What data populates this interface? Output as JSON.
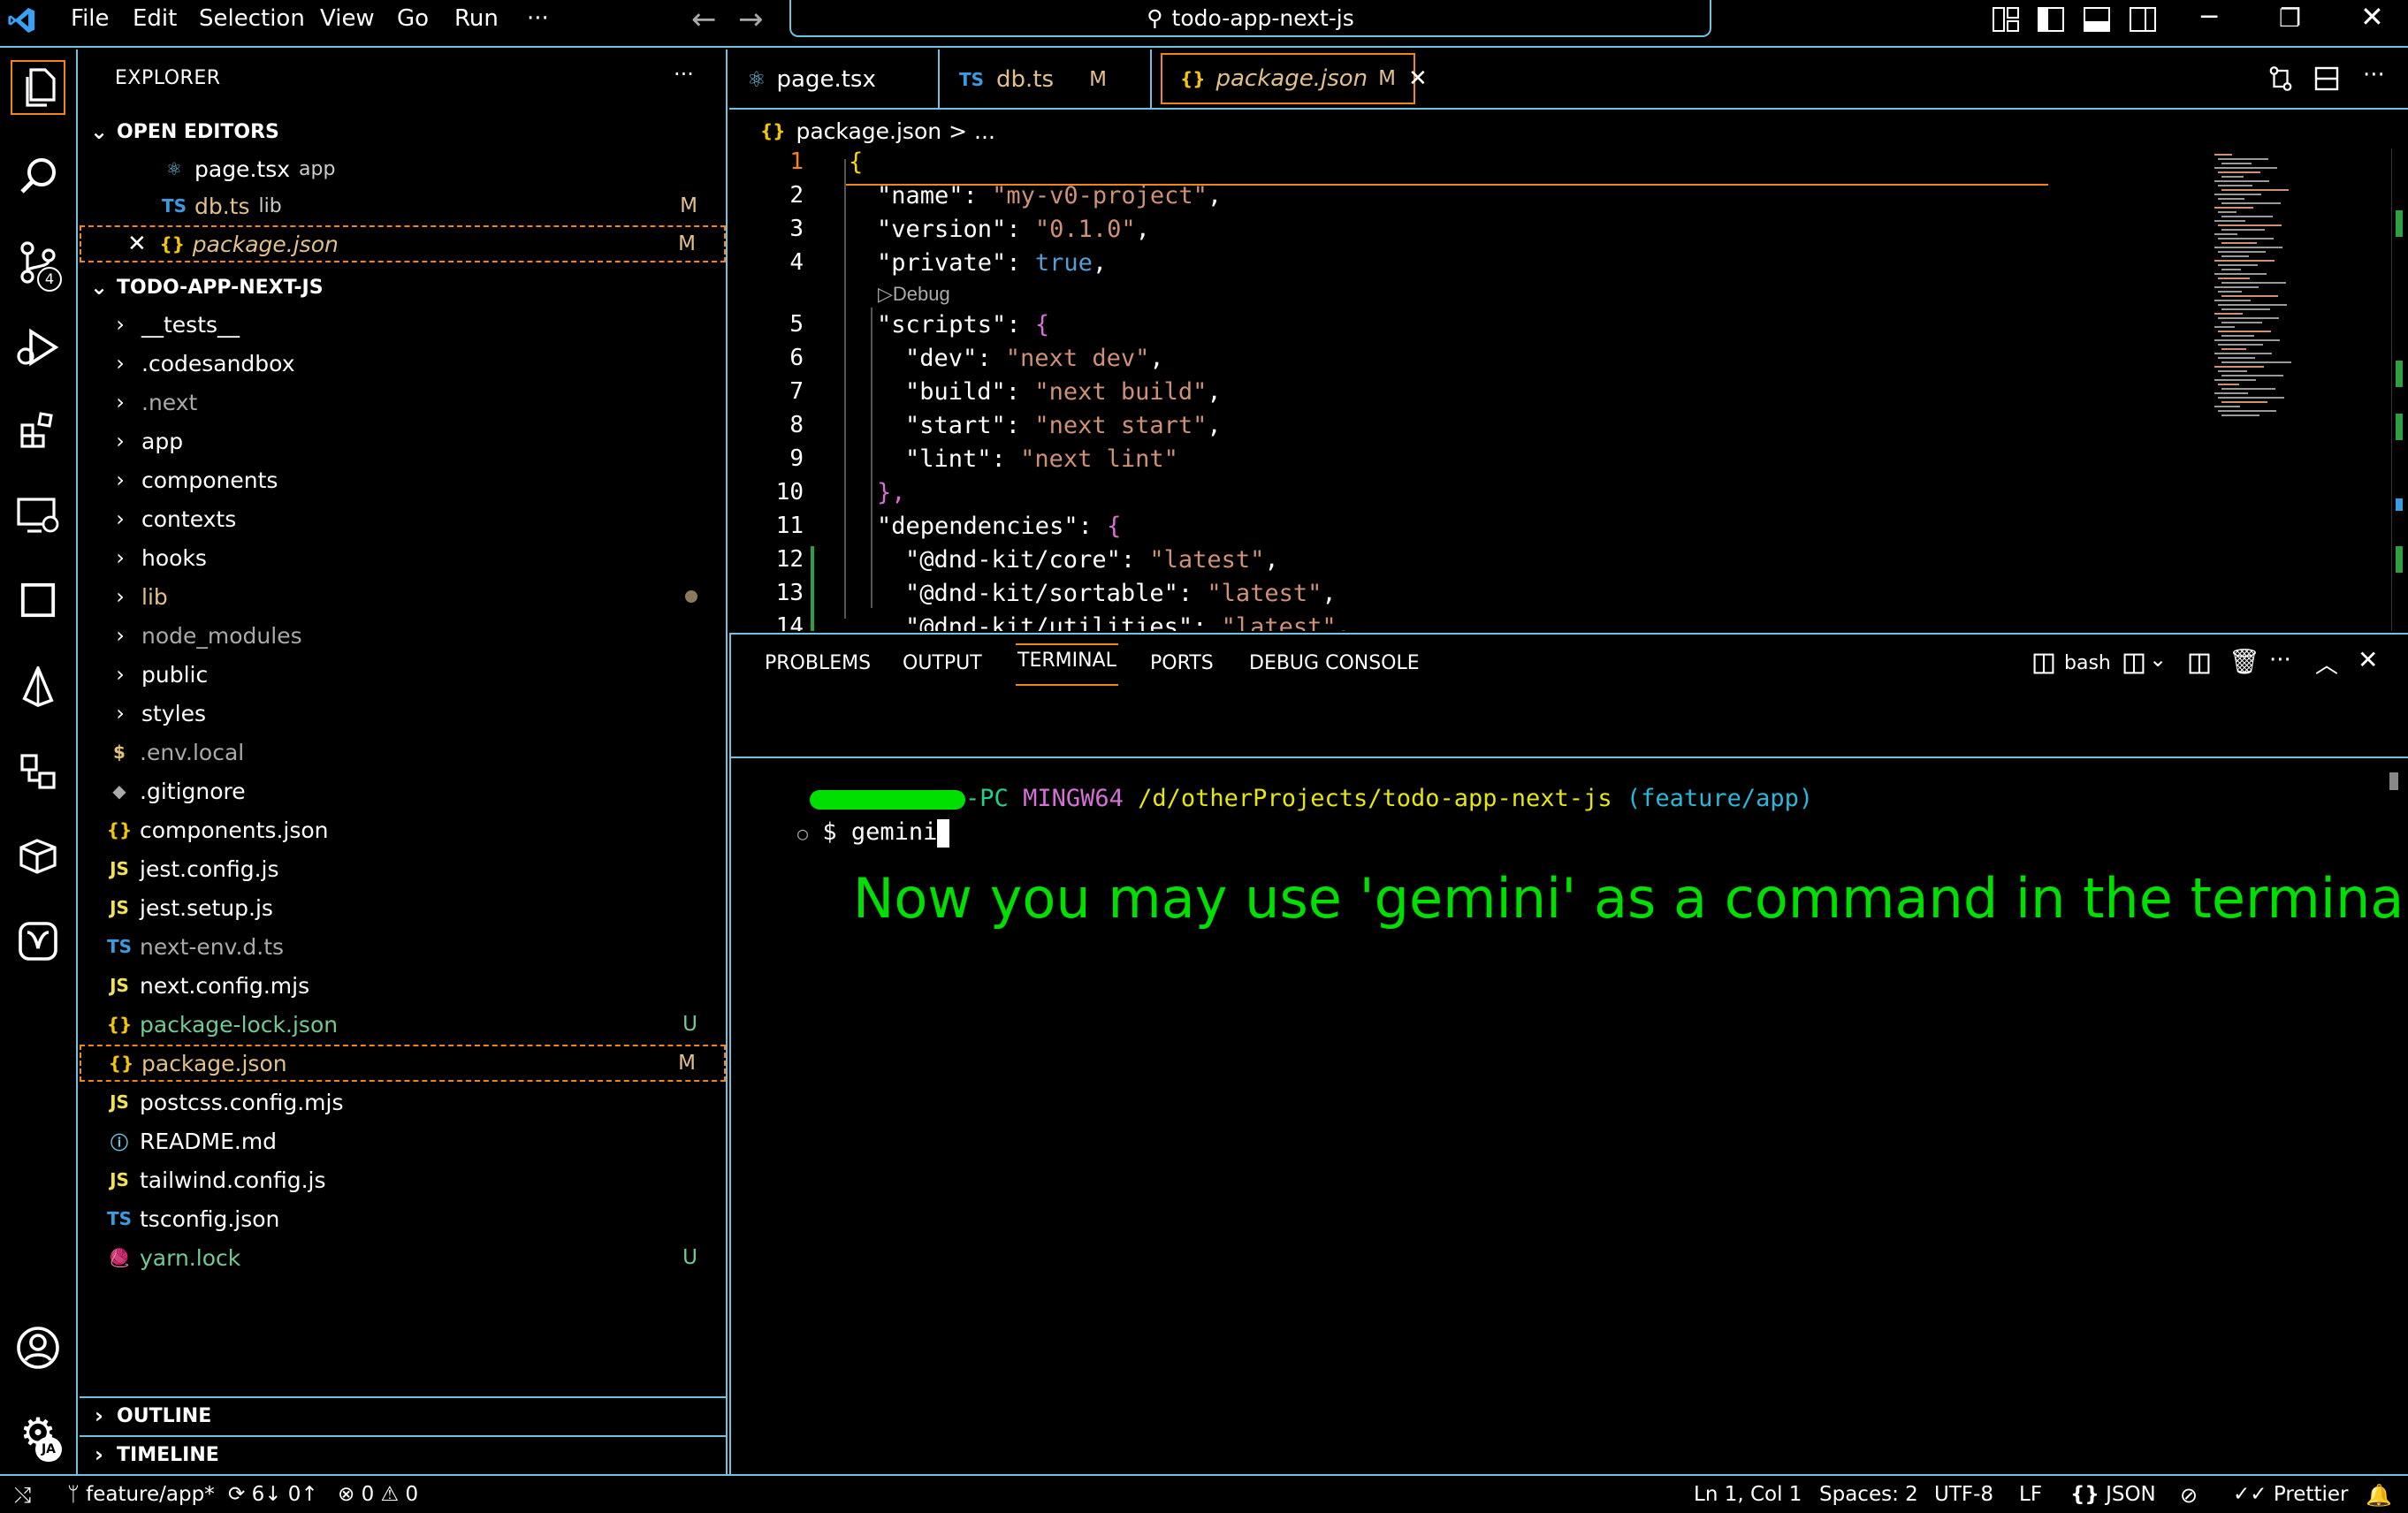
{
  "menu": {
    "file": "File",
    "edit": "Edit",
    "selection": "Selection",
    "view": "View",
    "go": "Go",
    "run": "Run",
    "more": "···"
  },
  "search": {
    "text": "todo-app-next-js"
  },
  "activity": {
    "scm_badge": "4",
    "account_badge": "JA"
  },
  "explorer": {
    "title": "EXPLORER",
    "more": "···",
    "open_editors_label": "OPEN EDITORS",
    "open_editors": [
      {
        "icon": "react",
        "name": "page.tsx",
        "detail": "app",
        "badge": ""
      },
      {
        "icon": "TS",
        "name": "db.ts",
        "detail": "lib",
        "badge": "M"
      },
      {
        "icon": "{}",
        "name": "package.json",
        "detail": "",
        "badge": "M"
      }
    ],
    "project_label": "TODO-APP-NEXT-JS",
    "folders": [
      "__tests__",
      ".codesandbox",
      ".next",
      "app",
      "components",
      "contexts",
      "hooks",
      "lib",
      "node_modules",
      "public",
      "styles"
    ],
    "files": [
      {
        "icon": "$",
        "name": ".env.local",
        "badge": ""
      },
      {
        "icon": "◆",
        "name": ".gitignore",
        "badge": ""
      },
      {
        "icon": "{}",
        "name": "components.json",
        "badge": ""
      },
      {
        "icon": "JS",
        "name": "jest.config.js",
        "badge": ""
      },
      {
        "icon": "JS",
        "name": "jest.setup.js",
        "badge": ""
      },
      {
        "icon": "TS",
        "name": "next-env.d.ts",
        "badge": ""
      },
      {
        "icon": "JS",
        "name": "next.config.mjs",
        "badge": ""
      },
      {
        "icon": "{}",
        "name": "package-lock.json",
        "badge": "U"
      },
      {
        "icon": "{}",
        "name": "package.json",
        "badge": "M"
      },
      {
        "icon": "JS",
        "name": "postcss.config.mjs",
        "badge": ""
      },
      {
        "icon": "ⓘ",
        "name": "README.md",
        "badge": ""
      },
      {
        "icon": "JS",
        "name": "tailwind.config.js",
        "badge": ""
      },
      {
        "icon": "TS",
        "name": "tsconfig.json",
        "badge": ""
      },
      {
        "icon": "🧶",
        "name": "yarn.lock",
        "badge": "U"
      }
    ],
    "outline_label": "OUTLINE",
    "timeline_label": "TIMELINE"
  },
  "tabs": [
    {
      "icon": "⚛",
      "name": "page.tsx",
      "badge": ""
    },
    {
      "icon": "TS",
      "name": "db.ts",
      "badge": "M"
    },
    {
      "icon": "{}",
      "name": "package.json",
      "badge": "M"
    }
  ],
  "breadcrumb": {
    "icon": "{}",
    "file": "package.json",
    "sep": ">",
    "more": "..."
  },
  "editor": {
    "codelens": "Debug",
    "lines": [
      {
        "n": "1",
        "text": "{"
      },
      {
        "n": "2",
        "key": "\"name\"",
        "val": "\"my-v0-project\"",
        "end": ","
      },
      {
        "n": "3",
        "key": "\"version\"",
        "val": "\"0.1.0\"",
        "end": ","
      },
      {
        "n": "4",
        "key": "\"private\"",
        "val": "true",
        "end": ","
      },
      {
        "n": "5",
        "key": "\"scripts\"",
        "val": "{",
        "end": ""
      },
      {
        "n": "6",
        "key": "\"dev\"",
        "val": "\"next dev\"",
        "end": ","
      },
      {
        "n": "7",
        "key": "\"build\"",
        "val": "\"next build\"",
        "end": ","
      },
      {
        "n": "8",
        "key": "\"start\"",
        "val": "\"next start\"",
        "end": ","
      },
      {
        "n": "9",
        "key": "\"lint\"",
        "val": "\"next lint\"",
        "end": ""
      },
      {
        "n": "10",
        "text": "},"
      },
      {
        "n": "11",
        "key": "\"dependencies\"",
        "val": "{",
        "end": ""
      },
      {
        "n": "12",
        "key": "\"@dnd-kit/core\"",
        "val": "\"latest\"",
        "end": ","
      },
      {
        "n": "13",
        "key": "\"@dnd-kit/sortable\"",
        "val": "\"latest\"",
        "end": ","
      },
      {
        "n": "14",
        "key": "\"@dnd-kit/utilities\"",
        "val": "\"latest\"",
        "end": ","
      }
    ]
  },
  "panel": {
    "tabs": [
      "PROBLEMS",
      "OUTPUT",
      "TERMINAL",
      "PORTS",
      "DEBUG CONSOLE"
    ],
    "shell": "bash",
    "prompt_host": "-PC",
    "prompt_env": "MINGW64",
    "prompt_path": "/d/otherProjects/todo-app-next-js",
    "prompt_branch": "(feature/app)",
    "prompt_symbol": "$",
    "command": "gemini",
    "caption": "Now you may use 'gemini' as a command in the terminal"
  },
  "status": {
    "branch": "feature/app*",
    "sync": "6↓ 0↑",
    "errors": "0",
    "warnings": "0",
    "position": "Ln 1, Col 1",
    "spaces": "Spaces: 2",
    "encoding": "UTF-8",
    "eol": "LF",
    "language": "JSON",
    "formatter": "Prettier"
  },
  "colors": {
    "accent": "#6fc3df",
    "modified": "#e2c08d",
    "untracked": "#73c991",
    "active_border": "#f38518",
    "terminal_green": "#23d18b"
  }
}
